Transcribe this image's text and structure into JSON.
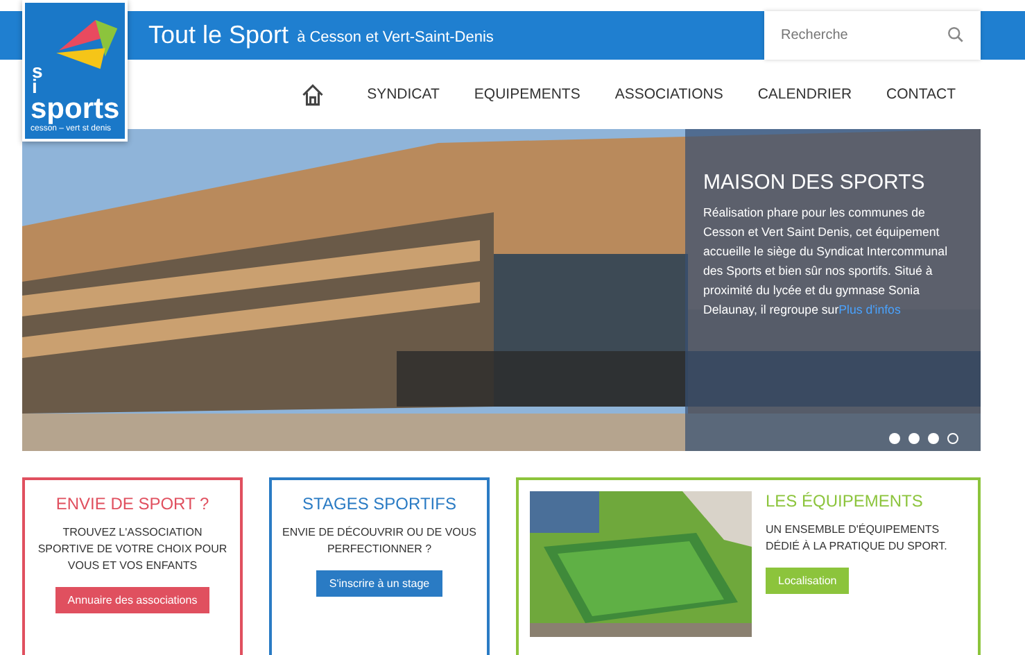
{
  "logo": {
    "letters": [
      "s",
      "i"
    ],
    "word": "sports",
    "tagline": "cesson – vert st denis"
  },
  "header": {
    "title": "Tout le Sport",
    "subtitle": "à Cesson et Vert-Saint-Denis"
  },
  "search": {
    "placeholder": "Recherche"
  },
  "nav": [
    {
      "label": "SYNDICAT"
    },
    {
      "label": "EQUIPEMENTS"
    },
    {
      "label": "ASSOCIATIONS"
    },
    {
      "label": "CALENDRIER"
    },
    {
      "label": "CONTACT"
    }
  ],
  "hero": {
    "title": "MAISON DES SPORTS",
    "text": "Réalisation phare pour les communes de Cesson et Vert Saint Denis, cet équipement accueille le siège du Syndicat Intercommunal des Sports et bien sûr nos sportifs. Situé à proximité du lycée et du gymnase Sonia Delaunay, il regroupe sur",
    "link": "Plus d'infos",
    "dots": [
      {
        "selected": false
      },
      {
        "selected": false
      },
      {
        "selected": false
      },
      {
        "selected": true
      }
    ]
  },
  "cards": [
    {
      "title": "ENVIE DE SPORT ?",
      "text": "TROUVEZ L'ASSOCIATION SPORTIVE DE VOTRE CHOIX POUR VOUS ET VOS ENFANTS",
      "button": "Annuaire des associations",
      "color": "#e0505f",
      "kind": "text"
    },
    {
      "title": "STAGES SPORTIFS",
      "text": "ENVIE DE DÉCOUVRIR OU DE VOUS PERFECTIONNER ?",
      "button": "S'inscrire à un stage",
      "color": "#2a7bc4",
      "kind": "text"
    },
    {
      "title": "LES ÉQUIPEMENTS",
      "text": "UN ENSEMBLE D'ÉQUIPEMENTS DÉDIÉ À LA PRATIQUE DU SPORT.",
      "button": "Localisation",
      "color": "#8cc43c",
      "kind": "picture"
    }
  ]
}
